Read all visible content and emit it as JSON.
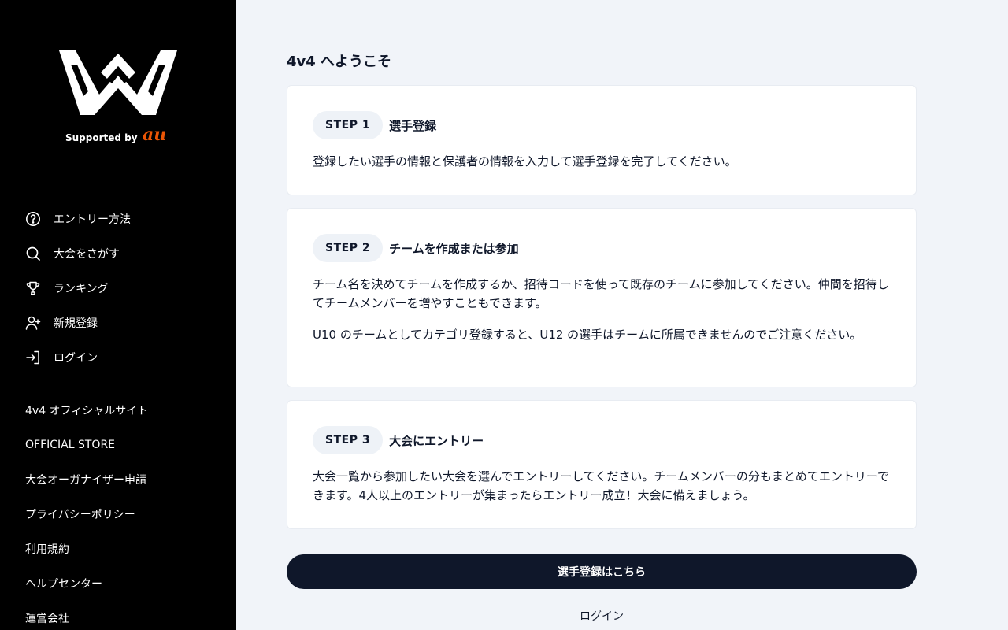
{
  "brand": {
    "supported_text": "Supported by",
    "sponsor": "au",
    "accent_color": "#eb5505"
  },
  "nav_primary": [
    {
      "label": "エントリー方法",
      "icon": "help-circle-icon"
    },
    {
      "label": "大会をさがす",
      "icon": "search-icon"
    },
    {
      "label": "ランキング",
      "icon": "trophy-icon"
    },
    {
      "label": "新規登録",
      "icon": "user-plus-icon"
    },
    {
      "label": "ログイン",
      "icon": "login-icon"
    }
  ],
  "nav_secondary": [
    {
      "label": "4v4 オフィシャルサイト"
    },
    {
      "label": "OFFICIAL STORE"
    },
    {
      "label": "大会オーガナイザー申請"
    },
    {
      "label": "プライバシーポリシー"
    },
    {
      "label": "利用規約"
    },
    {
      "label": "ヘルプセンター"
    },
    {
      "label": "運営会社"
    }
  ],
  "main": {
    "title": "4v4 へようこそ",
    "steps": [
      {
        "badge": "STEP 1",
        "title": "選手登録",
        "paragraphs": [
          "登録したい選手の情報と保護者の情報を入力して選手登録を完了してください。"
        ]
      },
      {
        "badge": "STEP 2",
        "title": "チームを作成または参加",
        "paragraphs": [
          "チーム名を決めてチームを作成するか、招待コードを使って既存のチームに参加してください。仲間を招待してチームメンバーを増やすこともできます。",
          "U10 のチームとしてカテゴリ登録すると、U12 の選手はチームに所属できませんのでご注意ください。"
        ]
      },
      {
        "badge": "STEP 3",
        "title": "大会にエントリー",
        "paragraphs": [
          "大会一覧から参加したい大会を選んでエントリーしてください。チームメンバーの分もまとめてエントリーできます。4人以上のエントリーが集まったらエントリー成立！大会に備えましょう。"
        ]
      }
    ],
    "cta_label": "選手登録はこちら",
    "login_label": "ログイン"
  }
}
